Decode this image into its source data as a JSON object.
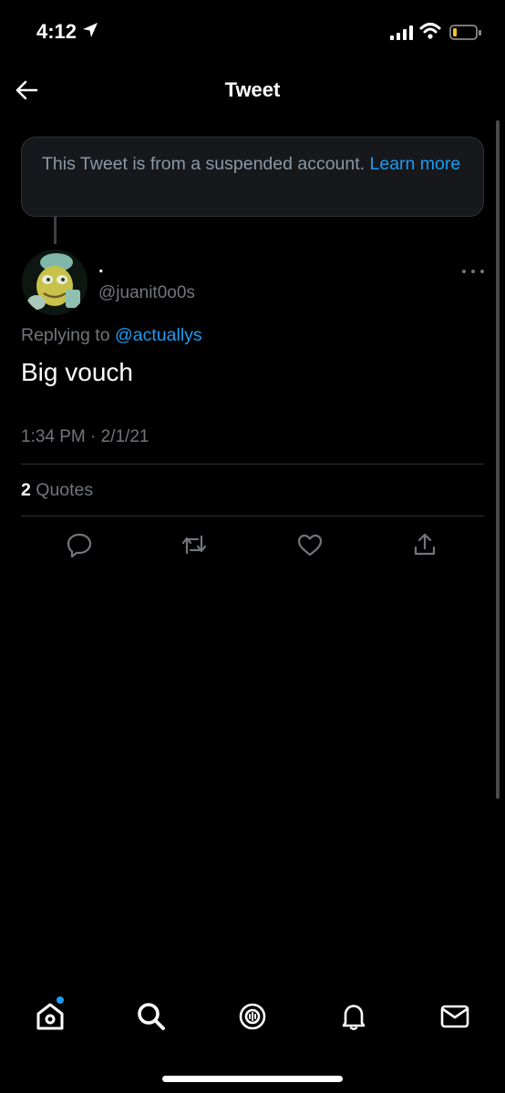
{
  "status_bar": {
    "time": "4:12"
  },
  "header": {
    "title": "Tweet"
  },
  "notice": {
    "text": "This Tweet is from a suspended account. ",
    "link": "Learn more"
  },
  "tweet": {
    "name": ".",
    "handle": "@juanit0o0s",
    "replying_prefix": "Replying to ",
    "replying_to": "@actuallys",
    "text": "Big vouch",
    "timestamp": "1:34 PM · 2/1/21",
    "quotes_count": "2",
    "quotes_label": " Quotes"
  },
  "actions": [
    "reply-icon",
    "retweet-icon",
    "like-icon",
    "share-icon"
  ],
  "tabbar": [
    "home-icon",
    "search-icon",
    "spaces-icon",
    "notifications-icon",
    "messages-icon"
  ],
  "colors": {
    "accent": "#1d9bf0",
    "background": "#000000",
    "muted": "#71767b"
  }
}
